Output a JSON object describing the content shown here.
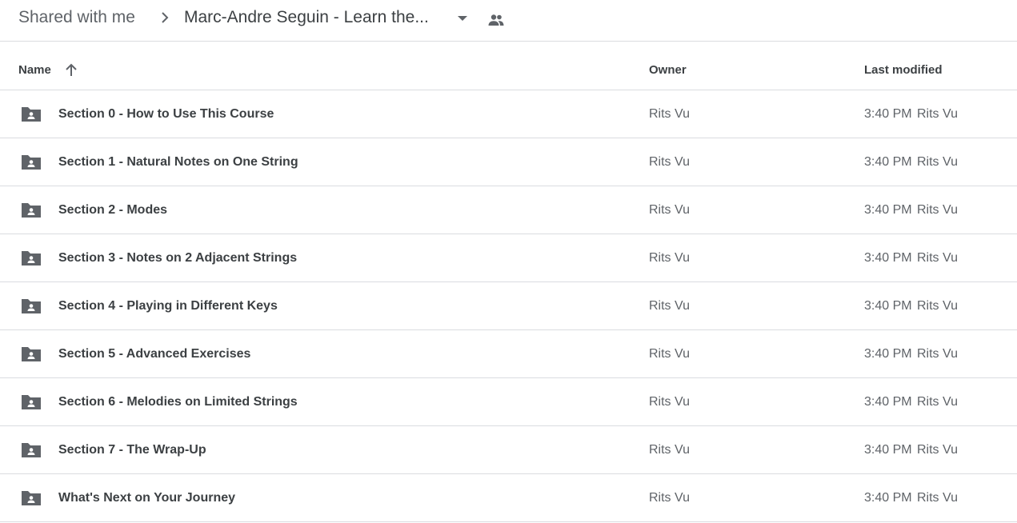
{
  "breadcrumb": {
    "root": "Shared with me",
    "current": "Marc-Andre Seguin - Learn the..."
  },
  "columns": {
    "name": "Name",
    "owner": "Owner",
    "last_modified": "Last modified"
  },
  "colors": {
    "icon": "#5f6368",
    "divider": "#dadce0",
    "text": "#3c4043"
  },
  "rows": [
    {
      "name": "Section 0 - How to Use This Course",
      "owner": "Rits Vu",
      "time": "3:40 PM",
      "modifier": "Rits Vu"
    },
    {
      "name": "Section 1 - Natural Notes on One String",
      "owner": "Rits Vu",
      "time": "3:40 PM",
      "modifier": "Rits Vu"
    },
    {
      "name": "Section 2 - Modes",
      "owner": "Rits Vu",
      "time": "3:40 PM",
      "modifier": "Rits Vu"
    },
    {
      "name": "Section 3 - Notes on 2 Adjacent Strings",
      "owner": "Rits Vu",
      "time": "3:40 PM",
      "modifier": "Rits Vu"
    },
    {
      "name": "Section 4 - Playing in Different Keys",
      "owner": "Rits Vu",
      "time": "3:40 PM",
      "modifier": "Rits Vu"
    },
    {
      "name": "Section 5 - Advanced Exercises",
      "owner": "Rits Vu",
      "time": "3:40 PM",
      "modifier": "Rits Vu"
    },
    {
      "name": "Section 6 - Melodies on Limited Strings",
      "owner": "Rits Vu",
      "time": "3:40 PM",
      "modifier": "Rits Vu"
    },
    {
      "name": "Section 7 - The Wrap-Up",
      "owner": "Rits Vu",
      "time": "3:40 PM",
      "modifier": "Rits Vu"
    },
    {
      "name": "What's Next on Your Journey",
      "owner": "Rits Vu",
      "time": "3:40 PM",
      "modifier": "Rits Vu"
    }
  ]
}
